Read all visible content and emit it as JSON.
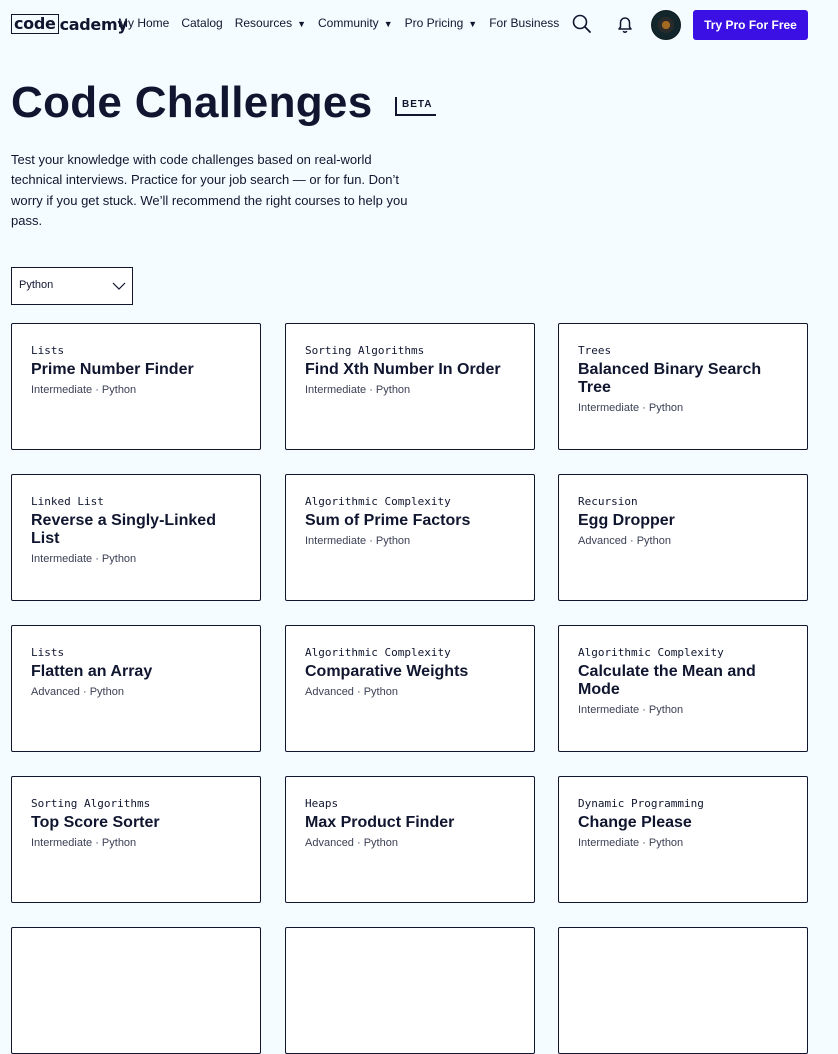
{
  "nav": {
    "logo_left": "code",
    "logo_right": "cademy",
    "links": [
      {
        "label": "My Home",
        "caret": ""
      },
      {
        "label": "Catalog",
        "caret": ""
      },
      {
        "label": "Resources",
        "caret": "▼"
      },
      {
        "label": "Community",
        "caret": "▼"
      },
      {
        "label": "Pro Pricing",
        "caret": "▼"
      },
      {
        "label": "For Business",
        "caret": ""
      }
    ],
    "search_icon": "search-icon",
    "bell_icon": "bell-icon",
    "cta_label": "Try Pro For Free",
    "cta_color": "#3a10e5"
  },
  "page": {
    "title": "Code Challenges",
    "badge": "BETA",
    "description": "Test your knowledge with code challenges based on real-world technical interviews. Practice for your job search — or for fun. Don’t worry if you get stuck. We’ll recommend the right courses to help you pass."
  },
  "filter": {
    "selected": "Python",
    "icon": "chevron-down-icon"
  },
  "cards": [
    {
      "category": "Lists",
      "title": "Prime Number Finder",
      "meta": "Intermediate · Python"
    },
    {
      "category": "Sorting Algorithms",
      "title": "Find Xth Number In Order",
      "meta": "Intermediate · Python"
    },
    {
      "category": "Trees",
      "title": "Balanced Binary Search Tree",
      "meta": "Intermediate · Python"
    },
    {
      "category": "Linked List",
      "title": "Reverse a Singly-Linked List",
      "meta": "Intermediate · Python"
    },
    {
      "category": "Algorithmic Complexity",
      "title": "Sum of Prime Factors",
      "meta": "Intermediate · Python"
    },
    {
      "category": "Recursion",
      "title": "Egg Dropper",
      "meta": "Advanced · Python"
    },
    {
      "category": "Lists",
      "title": "Flatten an Array",
      "meta": "Advanced · Python"
    },
    {
      "category": "Algorithmic Complexity",
      "title": "Comparative Weights",
      "meta": "Advanced · Python"
    },
    {
      "category": "Algorithmic Complexity",
      "title": "Calculate the Mean and Mode",
      "meta": "Intermediate · Python"
    },
    {
      "category": "Sorting Algorithms",
      "title": "Top Score Sorter",
      "meta": "Intermediate · Python"
    },
    {
      "category": "Heaps",
      "title": "Max Product Finder",
      "meta": "Advanced · Python"
    },
    {
      "category": "Dynamic Programming",
      "title": "Change Please",
      "meta": "Intermediate · Python"
    },
    {
      "category": "",
      "title": "",
      "meta": ""
    },
    {
      "category": "",
      "title": "",
      "meta": ""
    },
    {
      "category": "",
      "title": "",
      "meta": ""
    }
  ]
}
